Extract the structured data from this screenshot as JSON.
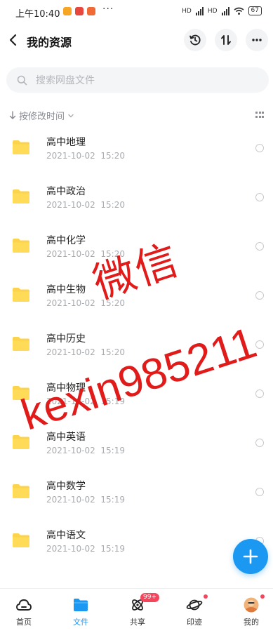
{
  "status_bar": {
    "time": "上午10:40",
    "more": "···",
    "network": "HD",
    "battery": "67"
  },
  "header": {
    "title": "我的资源",
    "back_icon": "chevron-left-icon",
    "history_icon": "clock-history-icon",
    "sort_icon": "sort-arrows-icon",
    "more_icon": "more-dots-icon"
  },
  "search": {
    "placeholder": "搜索网盘文件"
  },
  "sort_bar": {
    "label": "按修改时间",
    "view_icon": "grid-view-icon"
  },
  "files": [
    {
      "name": "高中地理",
      "date": "2021-10-02",
      "time": "15:20"
    },
    {
      "name": "高中政治",
      "date": "2021-10-02",
      "time": "15:20"
    },
    {
      "name": "高中化学",
      "date": "2021-10-02",
      "time": "15:20"
    },
    {
      "name": "高中生物",
      "date": "2021-10-02",
      "time": "15:20"
    },
    {
      "name": "高中历史",
      "date": "2021-10-02",
      "time": "15:20"
    },
    {
      "name": "高中物理",
      "date": "2021-10-02",
      "time": "15:19"
    },
    {
      "name": "高中英语",
      "date": "2021-10-02",
      "time": "15:19"
    },
    {
      "name": "高中数学",
      "date": "2021-10-02",
      "time": "15:19"
    },
    {
      "name": "高中语文",
      "date": "2021-10-02",
      "time": "15:19"
    }
  ],
  "watermark": {
    "line1": "微信",
    "line2": "kexin985211"
  },
  "bottom_nav": [
    {
      "label": "首页",
      "icon": "cloud-home-icon"
    },
    {
      "label": "文件",
      "icon": "folder-icon",
      "active": true
    },
    {
      "label": "共享",
      "icon": "share-atom-icon",
      "badge": "99+"
    },
    {
      "label": "印迹",
      "icon": "planet-icon"
    },
    {
      "label": "我的",
      "icon": "avatar"
    }
  ],
  "colors": {
    "accent": "#1a98f2",
    "folder": "#fcd34d",
    "badge": "#f5455c",
    "watermark": "#e11a1a"
  }
}
